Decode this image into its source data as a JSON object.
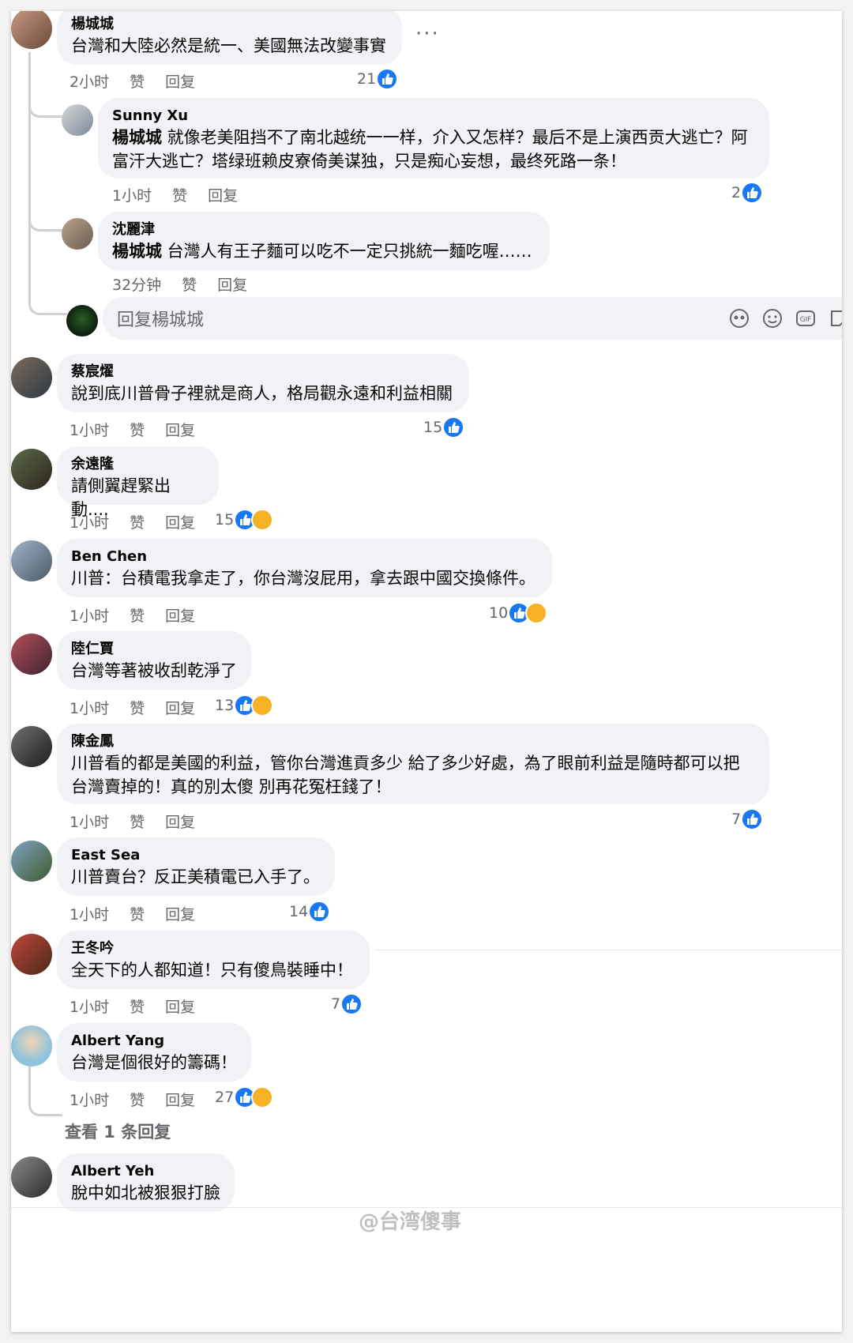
{
  "ui": {
    "like_label": "赞",
    "reply_label": "回复",
    "more_label": "···"
  },
  "comments": [
    {
      "author": "楊城城",
      "text": "台灣和大陸必然是統一、美國無法改變事實",
      "time": "2小时",
      "count": "21"
    },
    {
      "author": "Sunny Xu",
      "mention": "楊城城",
      "text": " 就像老美阻挡不了南北越统一一样，介入又怎样？最后不是上演西贡大逃亡？阿富汗大逃亡？塔绿班赖皮寮倚美谋独，只是痴心妄想，最终死路一条！",
      "time": "1小时",
      "count": "2"
    },
    {
      "author": "沈麗津",
      "mention": "楊城城",
      "text": " 台灣人有王子麵可以吃不一定只挑統一麵吃喔……",
      "time": "32分钟"
    },
    {
      "author": "蔡宸燿",
      "text": "說到底川普骨子裡就是商人，格局觀永遠和利益相關",
      "time": "1小时",
      "count": "15"
    },
    {
      "author": "余遠隆",
      "text": "請側翼趕緊出動....",
      "time": "1小时",
      "count": "15"
    },
    {
      "author": "Ben Chen",
      "text": "川普：台積電我拿走了，你台灣沒屁用，拿去跟中國交換條件。",
      "time": "1小时",
      "count": "10"
    },
    {
      "author": "陸仁賈",
      "text": "台灣等著被收刮乾淨了",
      "time": "1小时",
      "count": "13"
    },
    {
      "author": "陳金鳳",
      "text": "川普看的都是美國的利益，管你台灣進貢多少 給了多少好處，為了眼前利益是隨時都可以把台灣賣掉的！真的別太傻 別再花冤枉錢了！",
      "time": "1小时",
      "count": "7"
    },
    {
      "author": "East Sea",
      "text": "川普賣台？反正美積電已入手了。",
      "time": "1小时",
      "count": "14"
    },
    {
      "author": "王冬吟",
      "text": "全天下的人都知道！只有傻鳥裝睡中！",
      "time": "1小时",
      "count": "7"
    },
    {
      "author": "Albert Yang",
      "text": "台灣是個很好的籌碼！",
      "time": "1小时",
      "count": "27"
    },
    {
      "author": "Albert Yeh",
      "text": "脫中如北被狠狠打臉"
    }
  ],
  "reply_input": {
    "placeholder": "回复楊城城"
  },
  "view_replies": "查看 1 条回复",
  "watermark": "@台湾傻事",
  "colors": {
    "like_blue": "#1877f2",
    "bubble": "#f0f2f5",
    "meta_gray": "#65676b"
  }
}
